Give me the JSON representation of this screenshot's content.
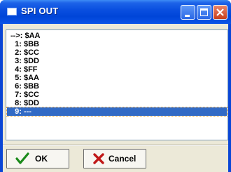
{
  "window": {
    "title": "SPI OUT"
  },
  "list": {
    "items": [
      "-->: $AA",
      "  1: $BB",
      "  2: $CC",
      "  3: $DD",
      "  4: $FF",
      "  5: $AA",
      "  6: $BB",
      "  7: $CC",
      "  8: $DD",
      "  9: ---"
    ],
    "selected_index": 9
  },
  "buttons": {
    "ok_label": "OK",
    "cancel_label": "Cancel"
  },
  "icons": {
    "title": "window-icon",
    "ok": "checkmark-icon",
    "cancel": "x-cross-icon"
  },
  "colors": {
    "titlebar": "#0a4fe0",
    "selection": "#316ac5",
    "ok_check": "#1a8a1a",
    "cancel_x": "#c01818"
  }
}
